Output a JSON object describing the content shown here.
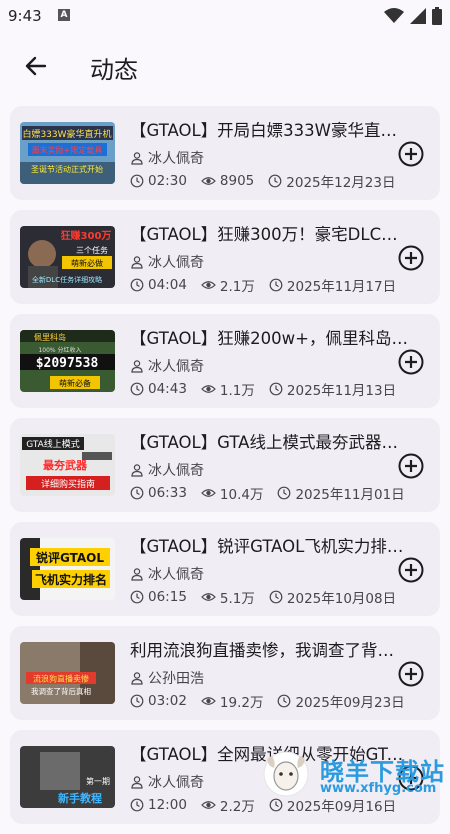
{
  "status": {
    "time": "9:43",
    "notif_badge": "A",
    "icons": [
      "wifi-icon",
      "signal-icon",
      "battery-icon"
    ]
  },
  "header": {
    "title": "动态",
    "back_icon": "arrow-left-icon"
  },
  "colors": {
    "background": "#fbf8fd",
    "card": "#f1edf4",
    "text": "#1c1b1f",
    "secondary": "#49454f",
    "watermark": "#2b9be0"
  },
  "videos": [
    {
      "title": "【GTAOL】开局白嫖333W豪华直升…",
      "author": "冰人佩奇",
      "duration": "02:30",
      "views": "8905",
      "date": "2025年12月23日",
      "thumb_text": [
        "白嫖333W豪华直升机",
        "周末奖励+限定载具",
        "圣诞节活动正式开始"
      ]
    },
    {
      "title": "【GTAOL】狂赚300万！豪宅DLC准…",
      "author": "冰人佩奇",
      "duration": "04:04",
      "views": "2.1万",
      "date": "2025年11月17日",
      "thumb_text": [
        "狂赚300万",
        "三个任务",
        "萌新必做",
        "全新DLC任务详细攻略"
      ]
    },
    {
      "title": "【GTAOL】狂赚200w+，佩里科岛…",
      "author": "冰人佩奇",
      "duration": "04:43",
      "views": "1.1万",
      "date": "2025年11月13日",
      "thumb_text": [
        "佩里科岛",
        "$2097538",
        "100% 分红收入",
        "萌新必备"
      ]
    },
    {
      "title": "【GTAOL】GTA线上模式最夯武器…",
      "author": "冰人佩奇",
      "duration": "06:33",
      "views": "10.4万",
      "date": "2025年11月01日",
      "thumb_text": [
        "GTA线上模式",
        "最夯武器",
        "详细购买指南"
      ]
    },
    {
      "title": "【GTAOL】锐评GTAOL飞机实力排…",
      "author": "冰人佩奇",
      "duration": "06:15",
      "views": "5.1万",
      "date": "2025年10月08日",
      "thumb_text": [
        "锐评GTAOL",
        "飞机实力排名"
      ]
    },
    {
      "title": "利用流浪狗直播卖惨，我调查了背…",
      "author": "公孙田浩",
      "duration": "03:02",
      "views": "19.2万",
      "date": "2025年09月23日",
      "thumb_text": [
        "流浪狗直播卖惨",
        "我调查了背后真相"
      ]
    },
    {
      "title": "【GTAOL】全网最详细从零开始GTA…",
      "author": "冰人佩奇",
      "duration": "12:00",
      "views": "2.2万",
      "date": "2025年09月16日",
      "thumb_text": [
        "第一期",
        "新手教程"
      ]
    }
  ],
  "watermark": {
    "name": "晓羊下载站",
    "url": "www.xfhyg.com"
  }
}
